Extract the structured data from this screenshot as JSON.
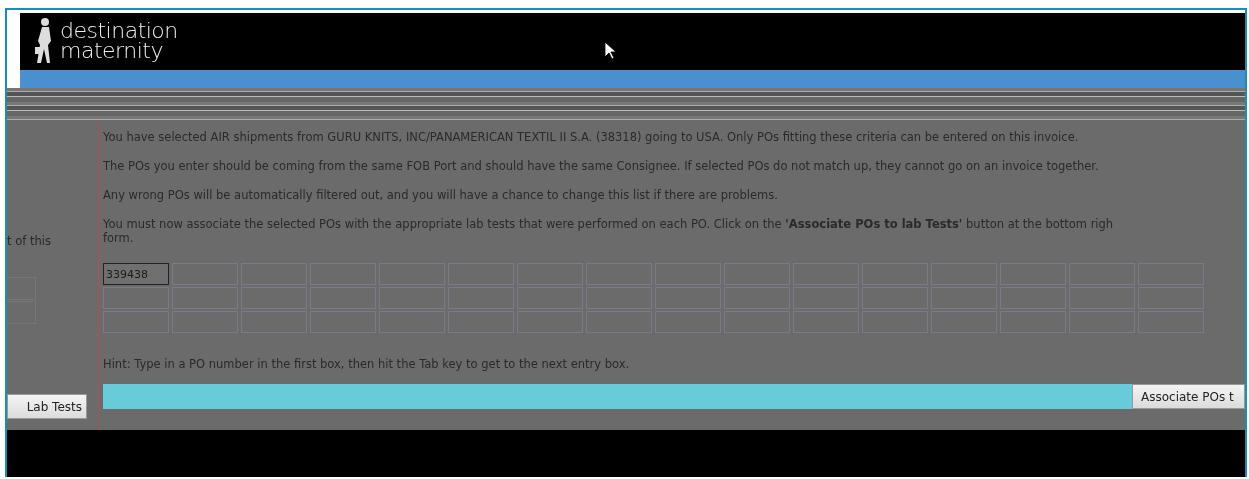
{
  "logo": {
    "line1": "destination",
    "line2": "maternity"
  },
  "left_panel": {
    "text": "t of this",
    "button": "Lab Tests"
  },
  "messages": [
    {
      "lines": [
        "You have selected AIR shipments from GURU KNITS, INC/PANAMERICAN TEXTIL II S.A. (38318) going to USA. Only POs fitting these criteria can be entered on this invoice."
      ]
    },
    {
      "lines": [
        "The POs you enter should be coming from the same FOB Port and should have the same Consignee. If selected POs do not match up, they cannot go on an invoice together."
      ]
    },
    {
      "lines": [
        "Any wrong POs will be automatically filtered out, and you will have a chance to change this list if there are problems."
      ]
    },
    {
      "lines": [
        "You must now associate the selected POs with the appropriate lab tests that were performed on each PO. Click on the **'Associate POs to lab Tests'** button at the bottom righ",
        "form."
      ]
    }
  ],
  "po_values": [
    "339438"
  ],
  "hint": "Hint: Type in a PO number in the first box, then hit the Tab key to get to the next entry box.",
  "associate_button": "Associate POs t"
}
